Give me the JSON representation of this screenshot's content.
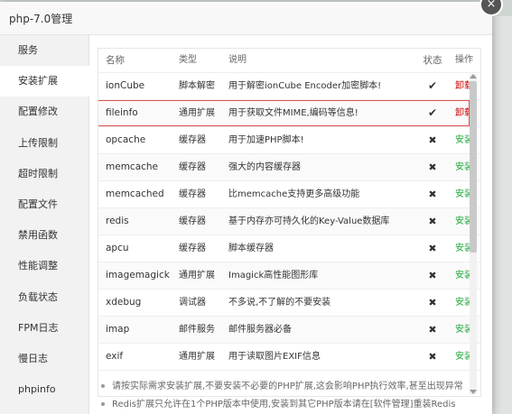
{
  "dialog": {
    "title": "php-7.0管理",
    "close_glyph": "×"
  },
  "sidebar": {
    "items": [
      {
        "label": "服务"
      },
      {
        "label": "安装扩展",
        "active": true
      },
      {
        "label": "配置修改"
      },
      {
        "label": "上传限制"
      },
      {
        "label": "超时限制"
      },
      {
        "label": "配置文件"
      },
      {
        "label": "禁用函数"
      },
      {
        "label": "性能调整"
      },
      {
        "label": "负载状态"
      },
      {
        "label": "FPM日志"
      },
      {
        "label": "慢日志"
      },
      {
        "label": "phpinfo"
      }
    ]
  },
  "table": {
    "headers": {
      "name": "名称",
      "type": "类型",
      "desc": "说明",
      "status": "状态",
      "action": "操作"
    },
    "rows": [
      {
        "name": "ionCube",
        "type": "脚本解密",
        "desc": "用于解密ionCube Encoder加密脚本!",
        "status": "✔",
        "action": "卸载"
      },
      {
        "name": "fileinfo",
        "type": "通用扩展",
        "desc": "用于获取文件MIME,编码等信息!",
        "status": "✔",
        "action": "卸载",
        "highlighted": true
      },
      {
        "name": "opcache",
        "type": "缓存器",
        "desc": "用于加速PHP脚本!",
        "status": "✖",
        "action": "安装"
      },
      {
        "name": "memcache",
        "type": "缓存器",
        "desc": "强大的内容缓存器",
        "status": "✖",
        "action": "安装"
      },
      {
        "name": "memcached",
        "type": "缓存器",
        "desc": "比memcache支持更多高级功能",
        "status": "✖",
        "action": "安装"
      },
      {
        "name": "redis",
        "type": "缓存器",
        "desc": "基于内存亦可持久化的Key-Value数据库",
        "status": "✖",
        "action": "安装"
      },
      {
        "name": "apcu",
        "type": "缓存器",
        "desc": "脚本缓存器",
        "status": "✖",
        "action": "安装"
      },
      {
        "name": "imagemagick",
        "type": "通用扩展",
        "desc": "Imagick高性能图形库",
        "status": "✖",
        "action": "安装"
      },
      {
        "name": "xdebug",
        "type": "调试器",
        "desc": "不多说,不了解的不要安装",
        "status": "✖",
        "action": "安装"
      },
      {
        "name": "imap",
        "type": "邮件服务",
        "desc": "邮件服务器必备",
        "status": "✖",
        "action": "安装"
      },
      {
        "name": "exif",
        "type": "通用扩展",
        "desc": "用于读取图片EXIF信息",
        "status": "✖",
        "action": "安装"
      }
    ]
  },
  "notes": [
    "请按实际需求安装扩展,不要安装不必要的PHP扩展,这会影响PHP执行效率,甚至出现异常",
    "Redis扩展只允许在1个PHP版本中使用,安装到其它PHP版本请在[软件管理]重装Redis"
  ],
  "colors": {
    "uninstall": "#cc0000",
    "install": "#20a53a",
    "highlight_border": "#e05050"
  }
}
